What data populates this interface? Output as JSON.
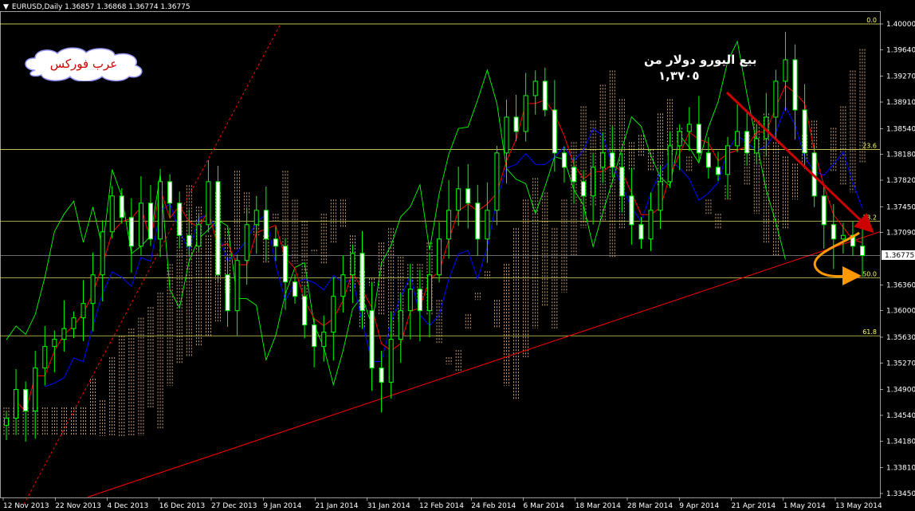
{
  "window": {
    "title": "EURUSD,Daily  1.36857 1.36868 1.36774 1.36775"
  },
  "logo": {
    "text": "عرب فوركس"
  },
  "annotation": {
    "line1": "بيع اليورو دولار من",
    "line2": "١,٣٧٠٥"
  },
  "colors": {
    "background": "#000000",
    "candle": "#00ff00",
    "tenkan": "#ff0000",
    "kijun": "#0000ff",
    "chikou": "#00ff00",
    "cloud": "#ffcc99",
    "trendline": "#ff0000",
    "fib": "#ffff66",
    "arrow_red": "#cc0000",
    "arrow_orange": "#ff9900"
  },
  "chart_data": {
    "type": "candlestick",
    "symbol": "EURUSD",
    "timeframe": "Daily",
    "ohlc_current": {
      "open": 1.36857,
      "high": 1.36868,
      "low": 1.36774,
      "close": 1.36775
    },
    "current_price_label": "1.36775",
    "y_ticks": [
      "1.40000",
      "1.39640",
      "1.39270",
      "1.38910",
      "1.38540",
      "1.38180",
      "1.37820",
      "1.37450",
      "1.37090",
      "1.36360",
      "1.36000",
      "1.35630",
      "1.35270",
      "1.34900",
      "1.34540",
      "1.34180",
      "1.33810",
      "1.33450"
    ],
    "x_ticks": [
      "12 Nov 2013",
      "22 Nov 2013",
      "4 Dec 2013",
      "16 Dec 2013",
      "27 Dec 2013",
      "9 Jan 2014",
      "21 Jan 2014",
      "31 Jan 2014",
      "12 Feb 2014",
      "24 Feb 2014",
      "6 Mar 2014",
      "18 Mar 2014",
      "28 Mar 2014",
      "9 Apr 2014",
      "21 Apr 2014",
      "1 May 2014",
      "13 May 2014"
    ],
    "fib_levels": [
      {
        "label": "0.0",
        "price": 1.4
      },
      {
        "label": "23.6",
        "price": 1.3825
      },
      {
        "label": "38.2",
        "price": 1.3725
      },
      {
        "label": "50.0",
        "price": 1.3646
      },
      {
        "label": "61.8",
        "price": 1.3565
      }
    ],
    "ylim": [
      1.3345,
      1.4
    ],
    "candles_close_path": [
      1.345,
      1.349,
      1.346,
      1.352,
      1.355,
      1.356,
      1.3575,
      1.359,
      1.361,
      1.365,
      1.371,
      1.376,
      1.373,
      1.369,
      1.375,
      1.37,
      1.378,
      1.375,
      1.3705,
      1.369,
      1.372,
      1.378,
      1.365,
      1.36,
      1.367,
      1.372,
      1.374,
      1.37,
      1.369,
      1.364,
      1.362,
      1.358,
      1.355,
      1.357,
      1.362,
      1.365,
      1.368,
      1.36,
      1.352,
      1.35,
      1.356,
      1.36,
      1.363,
      1.36,
      1.365,
      1.37,
      1.374,
      1.377,
      1.375,
      1.37,
      1.374,
      1.382,
      1.387,
      1.385,
      1.39,
      1.392,
      1.388,
      1.382,
      1.38,
      1.378,
      1.376,
      1.38,
      1.382,
      1.38,
      1.376,
      1.372,
      1.37,
      1.374,
      1.378,
      1.383,
      1.385,
      1.386,
      1.382,
      1.38,
      1.379,
      1.383,
      1.385,
      1.382,
      1.384,
      1.387,
      1.392,
      1.395,
      1.388,
      1.382,
      1.376,
      1.372,
      1.37,
      1.3705,
      1.369,
      1.3677
    ]
  }
}
